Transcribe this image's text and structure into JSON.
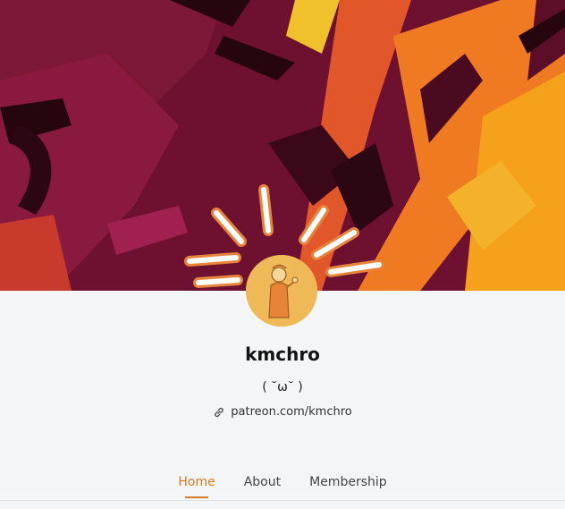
{
  "creator": {
    "name": "kmchro",
    "tagline": "( ˘ω˘ )",
    "link_text": "patreon.com/kmchro"
  },
  "tabs": [
    {
      "label": "Home",
      "active": true
    },
    {
      "label": "About",
      "active": false
    },
    {
      "label": "Membership",
      "active": false
    }
  ],
  "colors": {
    "accent": "#d7791f",
    "avatar_bg": "#f0b957",
    "banner_dark": "#6a0f2b",
    "banner_orange": "#e8722a"
  },
  "icons": {
    "link": "link-icon"
  }
}
